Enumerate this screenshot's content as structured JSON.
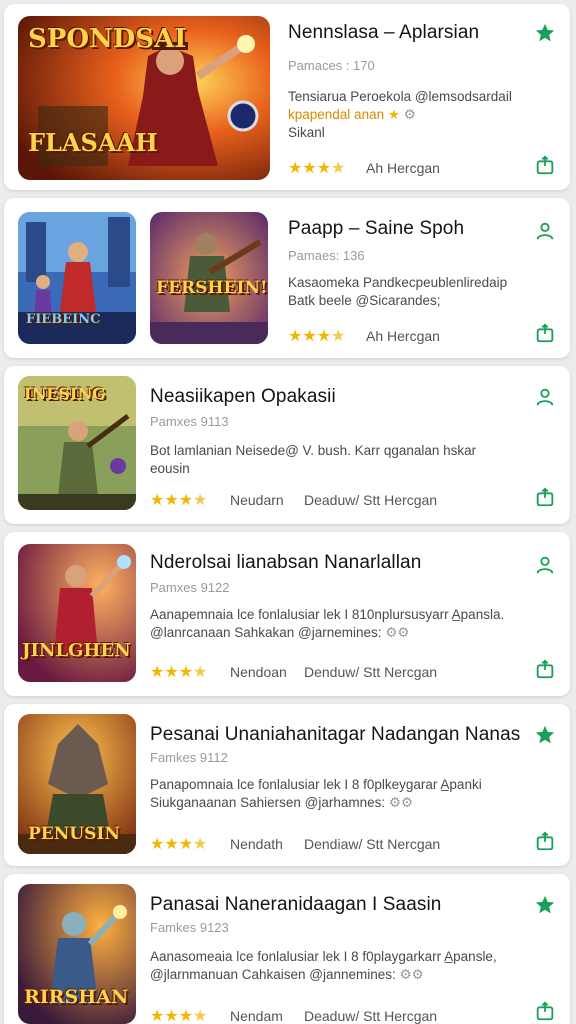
{
  "colors": {
    "accent": "#1aa05a",
    "star": "#f2b600",
    "highlight": "#d98a00"
  },
  "apps": [
    {
      "title": "Nennslasa – Aplarsian",
      "meta": "Pamaces : 170",
      "desc_line1": "Tensiarua Peroekola @lemsodsardail",
      "desc_line2": "kpapendal anan",
      "desc_line3": "Sikanl",
      "rating_text": "Ah Hercgan",
      "corner_icon": "star-icon",
      "thumb_logo": "SPONDSAI",
      "thumb_logo2": "FLASAAH"
    },
    {
      "title": "Paapp – Saine Spoh",
      "meta": "Pamaes: 136",
      "desc_line1": "Kasaomeka Pandkecpeublenliredaip",
      "desc_line2": "Batk beele @Sicarandes;",
      "rating_text": "Ah Hercgan",
      "corner_icon": "person-icon",
      "thumb_logo": "FIEBEINC",
      "thumb_logo2": "FERSHEIN!"
    },
    {
      "title": "Neasiikapen Opakasii",
      "meta": "Pamxes 9113",
      "desc_line1": "Bot lamlanian Neisede@ V. bush. Karr qganalan hskar",
      "desc_line2": "eousin",
      "rating_text": "Neudarn",
      "rating_text2": "Deaduw/ Stt Hercgan",
      "corner_icon": "person-icon",
      "thumb_logo": "INESING"
    },
    {
      "title": "Nderolsai lianabsan Nanarlallan",
      "meta": "Pamxes 9122",
      "desc_line1": "Aanapemnaia lce fonlalusiar lek I 810nplursusyarr A̲pansla.",
      "desc_line2": "@lanrcanaan Sahkakan @jarnemines:",
      "rating_text": "Nendoan",
      "rating_text2": "Denduw/ Stt Nercgan",
      "corner_icon": "person-icon",
      "thumb_logo": "JINLGHEN"
    },
    {
      "title": "Pesanai Unaniahanitagar Nadangan Nanas",
      "meta": "Famkes 9112",
      "desc_line1": "Panapomnaia lce fonlalusiar lek I 8 f0plkeygarar A̲panki",
      "desc_line2": "Siukganaanan Sahiersen @jarhamnes:",
      "rating_text": "Nendath",
      "rating_text2": "Dendiaw/ Stt Nercgan",
      "corner_icon": "star-icon",
      "thumb_logo": "PENUSIN"
    },
    {
      "title": "Panasai Naneranidaagan I Saasin",
      "meta": "Famkes 9123",
      "desc_line1": "Aanasomeaia lce fonlalusiar lek I 8 f0playgarkarr A̲pansle,",
      "desc_line2": "@jlarnmanuan Cahkaisen @jannemines:",
      "rating_text": "Nendam",
      "rating_text2": "Deaduw/ Stt Hercgan",
      "corner_icon": "star-icon",
      "thumb_logo": "RIRSHAN"
    }
  ]
}
